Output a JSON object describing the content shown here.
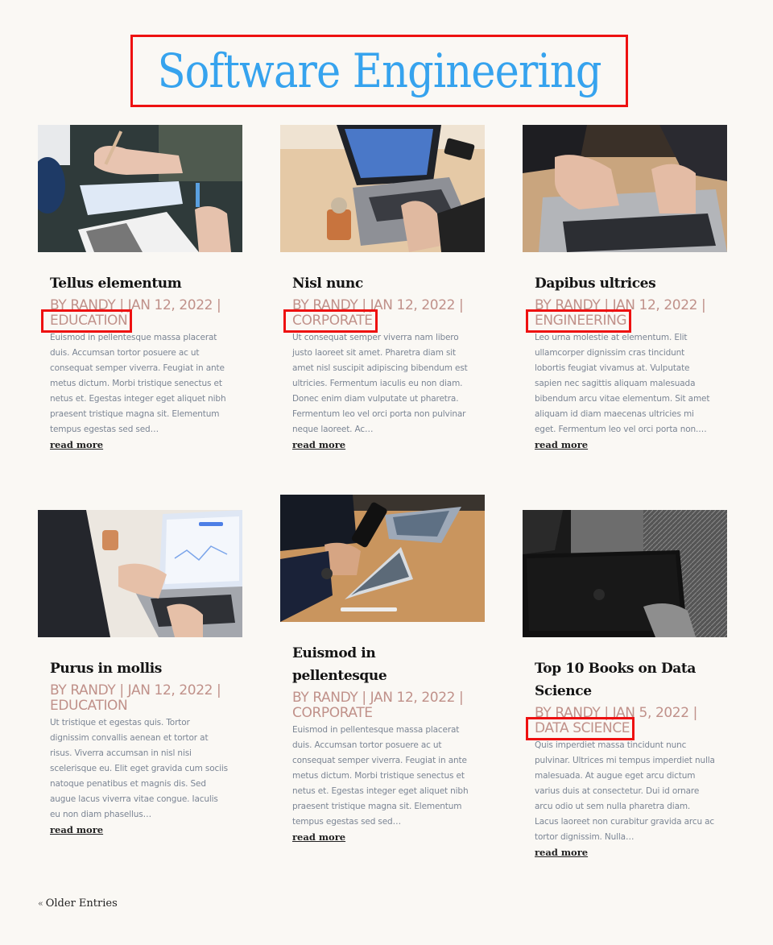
{
  "header": {
    "title": "Software Engineering"
  },
  "posts": [
    {
      "title": "Tellus elementum",
      "meta_prefix": "By Randy | Jan 12, 2022 |",
      "category": "Education",
      "category_highlighted": true,
      "excerpt": "Euismod in pellentesque massa placerat duis. Accumsan tortor posuere ac ut consequat semper viverra. Feugiat in ante metus dictum. Morbi tristique senectus et netus et. Egestas integer eget aliquet nibh praesent tristique magna sit. Elementum tempus egestas sed sed…",
      "read_more": "read more",
      "image": "laptop-notebook-writing"
    },
    {
      "title": "Nisl nunc",
      "meta_prefix": "By Randy | Jan 12, 2022 |",
      "category": "Corporate",
      "category_highlighted": true,
      "excerpt": "Ut consequat semper viverra nam libero justo laoreet sit amet. Pharetra diam sit amet nisl suscipit adipiscing bibendum est ultricies. Fermentum iaculis eu non diam. Donec enim diam vulputate ut pharetra. Fermentum leo vel orci porta non pulvinar neque laoreet. Ac…",
      "read_more": "read more",
      "image": "laptop-desk-plant"
    },
    {
      "title": "Dapibus ultrices",
      "meta_prefix": "By Randy | Jan 12, 2022 |",
      "category": "Engineering",
      "category_highlighted": true,
      "excerpt": "Leo urna molestie at elementum. Elit ullamcorper dignissim cras tincidunt lobortis feugiat vivamus at. Vulputate sapien nec sagittis aliquam malesuada bibendum arcu vitae elementum. Sit amet aliquam id diam maecenas ultricies mi eget. Fermentum leo vel orci porta non.…",
      "read_more": "read more",
      "image": "hands-typing-laptop"
    },
    {
      "title": "Purus in mollis",
      "meta_prefix": "By Randy | Jan 12, 2022 |",
      "category": "Education",
      "category_highlighted": false,
      "excerpt": "Ut tristique et egestas quis. Tortor dignissim convallis aenean et tortor at risus. Viverra accumsan in nisl nisi scelerisque eu. Elit eget gravida cum sociis natoque penatibus et magnis dis. Sed augue lacus viverra vitae congue. Iaculis eu non diam phasellus…",
      "read_more": "read more",
      "image": "laptop-charts"
    },
    {
      "title": "Euismod in pellentesque",
      "meta_prefix": "By Randy | Jan 12, 2022 |",
      "category": "Corporate",
      "category_highlighted": false,
      "excerpt": "Euismod in pellentesque massa placerat duis. Accumsan tortor posuere ac ut consequat semper viverra. Feugiat in ante metus dictum. Morbi tristique senectus et netus et. Egestas integer eget aliquet nibh praesent tristique magna sit. Elementum tempus egestas sed sed…",
      "read_more": "read more",
      "image": "phone-tablet-desk"
    },
    {
      "title": "Top 10 Books on Data Science",
      "meta_prefix": "By Randy | Jan 5, 2022 |",
      "category": "Data Science",
      "category_highlighted": true,
      "excerpt": "Quis imperdiet massa tincidunt nunc pulvinar. Ultrices mi tempus imperdiet nulla malesuada. At augue eget arcu dictum varius duis at consectetur. Dui id ornare arcu odio ut sem nulla pharetra diam. Lacus laoreet non curabitur gravida arcu ac tortor dignissim. Nulla…",
      "read_more": "read more",
      "image": "dark-laptop-bw"
    }
  ],
  "pagination": {
    "older_label": "Older Entries",
    "older_glyph": "«"
  },
  "colors": {
    "title": "#36a3ee",
    "meta": "#c0918a",
    "highlight": "#ee1111",
    "background": "#faf8f4"
  }
}
